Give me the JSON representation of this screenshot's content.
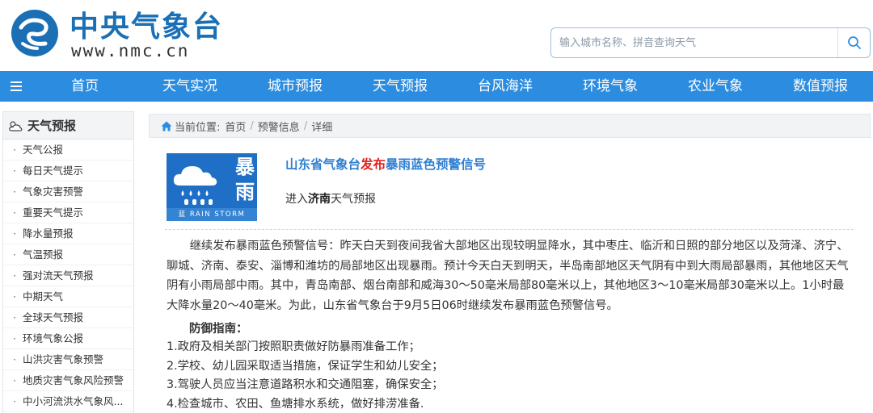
{
  "header": {
    "logo_cn": "中央气象台",
    "logo_en": "www.nmc.cn",
    "search_placeholder": "输入城市名称、拼音查询天气"
  },
  "nav": {
    "items": [
      "首页",
      "天气实况",
      "城市预报",
      "天气预报",
      "台风海洋",
      "环境气象",
      "农业气象",
      "数值预报"
    ]
  },
  "sidebar": {
    "title": "天气预报",
    "items": [
      "天气公报",
      "每日天气提示",
      "气象灾害预警",
      "重要天气提示",
      "降水量预报",
      "气温预报",
      "强对流天气预报",
      "中期天气",
      "全球天气预报",
      "环境气象公报",
      "山洪灾害气象预警",
      "地质灾害气象风险预警",
      "中小河流洪水气象风..."
    ]
  },
  "breadcrumb": {
    "label": "当前位置:",
    "items": [
      "首页",
      "预警信息",
      "详细"
    ]
  },
  "warning": {
    "icon_char_1": "暴",
    "icon_char_2": "雨",
    "icon_char_small": "蓝",
    "icon_en": "RAIN STORM",
    "title_org": "山东省气象台",
    "title_pub": "发布",
    "title_signal": "暴雨蓝色预警信号",
    "enter_prefix": "进入",
    "enter_city": "济南",
    "enter_suffix": "天气预报",
    "body": "继续发布暴雨蓝色预警信号：昨天白天到夜间我省大部地区出现较明显降水，其中枣庄、临沂和日照的部分地区以及菏泽、济宁、聊城、济南、泰安、淄博和潍坊的局部地区出现暴雨。预计今天白天到明天，半岛南部地区天气阴有中到大雨局部暴雨，其他地区天气阴有小雨局部中雨。其中，青岛南部、烟台南部和威海30～50毫米局部80毫米以上，其他地区3～10毫米局部30毫米以上。1小时最大降水量20～40毫米。为此，山东省气象台于9月5日06时继续发布暴雨蓝色预警信号。",
    "guide_title": "防御指南：",
    "guide_items": [
      "1.政府及相关部门按照职责做好防暴雨准备工作；",
      "2.学校、幼儿园采取适当措施，保证学生和幼儿安全；",
      "3.驾驶人员应当注意道路积水和交通阻塞，确保安全；",
      "4.检查城市、农田、鱼塘排水系统，做好排涝准备."
    ]
  },
  "colors": {
    "brand_blue": "#1b6fb5",
    "nav_blue": "#2c8de0",
    "warn_blue": "#1f6fc6",
    "title_blue": "#2f7fd1",
    "publish_red": "#e02020"
  }
}
